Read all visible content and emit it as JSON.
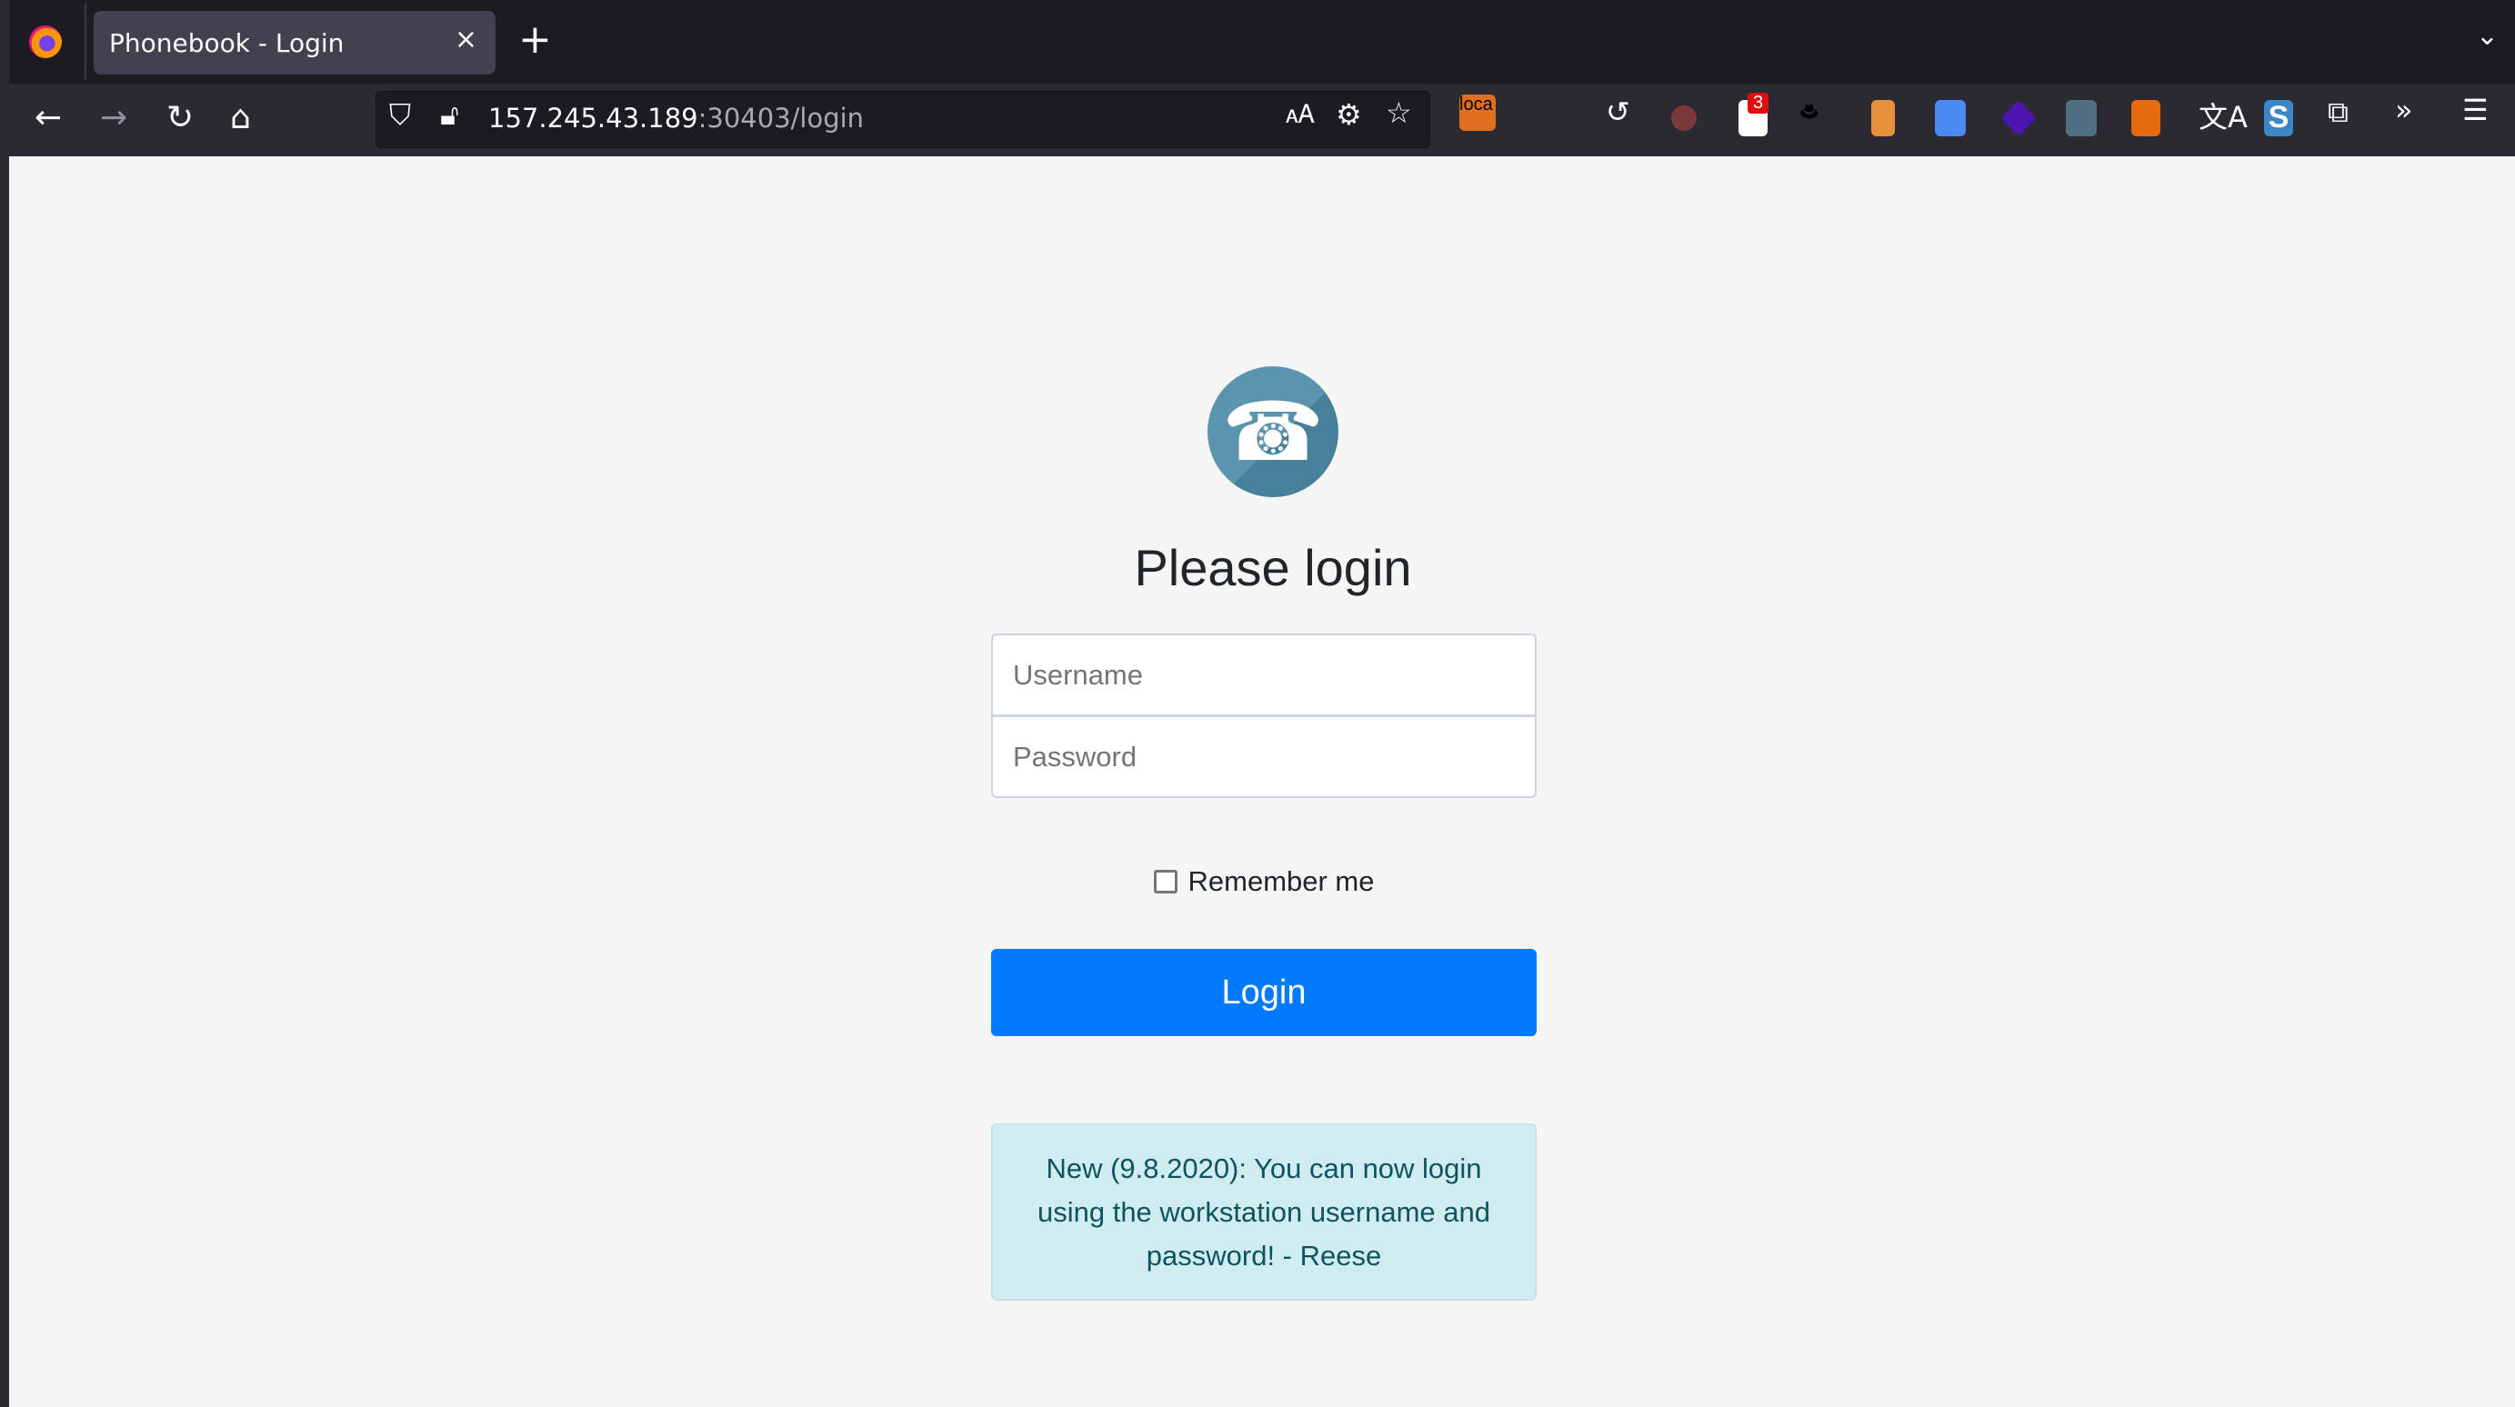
{
  "browser": {
    "tab_title": "Phonebook - Login",
    "tab_close": "×",
    "new_tab": "+",
    "url_host": "157.245.43.189",
    "url_rest": ":30403/login",
    "extension_badge": "3",
    "loca_label": "loca"
  },
  "page": {
    "heading": "Please login",
    "username_placeholder": "Username",
    "password_placeholder": "Password",
    "remember_label": "Remember me",
    "login_button": "Login",
    "notice": "New (9.8.2020): You can now login using the workstation username and password! - Reese"
  },
  "colors": {
    "primary": "#007bff",
    "alert_bg": "#d1ecf1",
    "alert_text": "#0c5460",
    "logo": "#5b94ae"
  }
}
